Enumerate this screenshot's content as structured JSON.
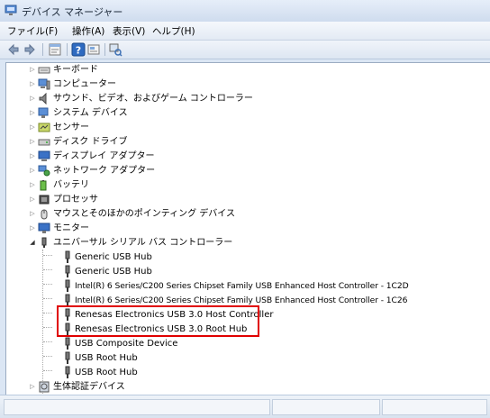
{
  "window": {
    "title": "デバイス マネージャー"
  },
  "menu": [
    {
      "label": "ファイル(F)"
    },
    {
      "label": "操作(A)"
    },
    {
      "label": "表示(V)"
    },
    {
      "label": "ヘルプ(H)"
    }
  ],
  "toolbar": [
    {
      "icon": "back-arrow-icon"
    },
    {
      "icon": "forward-arrow-icon"
    },
    {
      "icon": "properties-icon"
    },
    {
      "icon": "help-icon"
    },
    {
      "icon": "scan-hardware-icon"
    },
    {
      "icon": "device-scan-icon"
    }
  ],
  "tree": {
    "categories": [
      {
        "label": "キーボード",
        "icon": "keyboard-icon"
      },
      {
        "label": "コンピューター",
        "icon": "computer-icon"
      },
      {
        "label": "サウンド、ビデオ、およびゲーム コントローラー",
        "icon": "speaker-icon"
      },
      {
        "label": "システム デバイス",
        "icon": "system-device-icon"
      },
      {
        "label": "センサー",
        "icon": "sensor-icon"
      },
      {
        "label": "ディスク ドライブ",
        "icon": "disk-drive-icon"
      },
      {
        "label": "ディスプレイ アダプター",
        "icon": "display-adapter-icon"
      },
      {
        "label": "ネットワーク アダプター",
        "icon": "network-adapter-icon"
      },
      {
        "label": "バッテリ",
        "icon": "battery-icon"
      },
      {
        "label": "プロセッサ",
        "icon": "processor-icon"
      },
      {
        "label": "マウスとそのほかのポインティング デバイス",
        "icon": "mouse-icon"
      },
      {
        "label": "モニター",
        "icon": "monitor-icon"
      }
    ],
    "usb_category": {
      "label": "ユニバーサル シリアル バス コントローラー",
      "icon": "usb-controller-icon",
      "children": [
        {
          "label": "Generic USB Hub"
        },
        {
          "label": "Generic USB Hub"
        },
        {
          "label": "Intel(R) 6 Series/C200 Series Chipset Family USB Enhanced Host Controller - 1C2D"
        },
        {
          "label": "Intel(R) 6 Series/C200 Series Chipset Family USB Enhanced Host Controller - 1C26"
        },
        {
          "label": "Renesas Electronics USB 3.0 Host Controller"
        },
        {
          "label": "Renesas Electronics USB 3.0 Root Hub"
        },
        {
          "label": "USB Composite Device"
        },
        {
          "label": "USB Root Hub"
        },
        {
          "label": "USB Root Hub"
        }
      ]
    },
    "last_category": {
      "label": "生体認証デバイス",
      "icon": "biometric-icon"
    }
  },
  "highlight_color": "#e00000"
}
